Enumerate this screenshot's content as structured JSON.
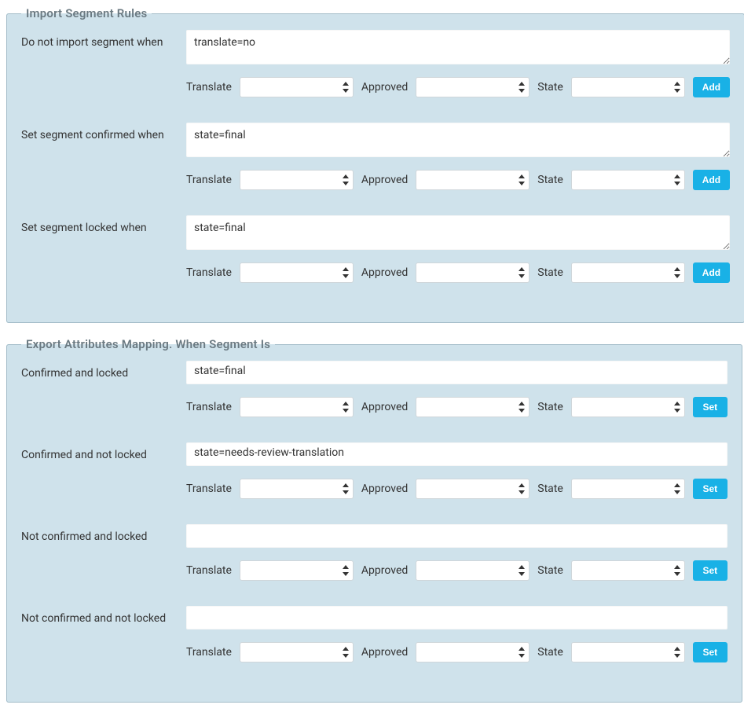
{
  "colors": {
    "accent": "#19b1e6",
    "panel_bg": "#cfe2eb",
    "legend": "#6b7a82"
  },
  "common_labels": {
    "translate": "Translate",
    "approved": "Approved",
    "state": "State"
  },
  "buttons": {
    "add": "Add",
    "set": "Set"
  },
  "import": {
    "legend": "Import Segment Rules",
    "rules": [
      {
        "label": "Do not import segment when",
        "value": "translate=no"
      },
      {
        "label": "Set segment confirmed when",
        "value": "state=final"
      },
      {
        "label": "Set segment locked when",
        "value": "state=final"
      }
    ]
  },
  "export": {
    "legend": "Export Attributes Mapping. When Segment Is",
    "rules": [
      {
        "label": "Confirmed and locked",
        "value": "state=final"
      },
      {
        "label": "Confirmed and not locked",
        "value": "state=needs-review-translation"
      },
      {
        "label": "Not confirmed and locked",
        "value": ""
      },
      {
        "label": "Not confirmed and not locked",
        "value": ""
      }
    ]
  }
}
